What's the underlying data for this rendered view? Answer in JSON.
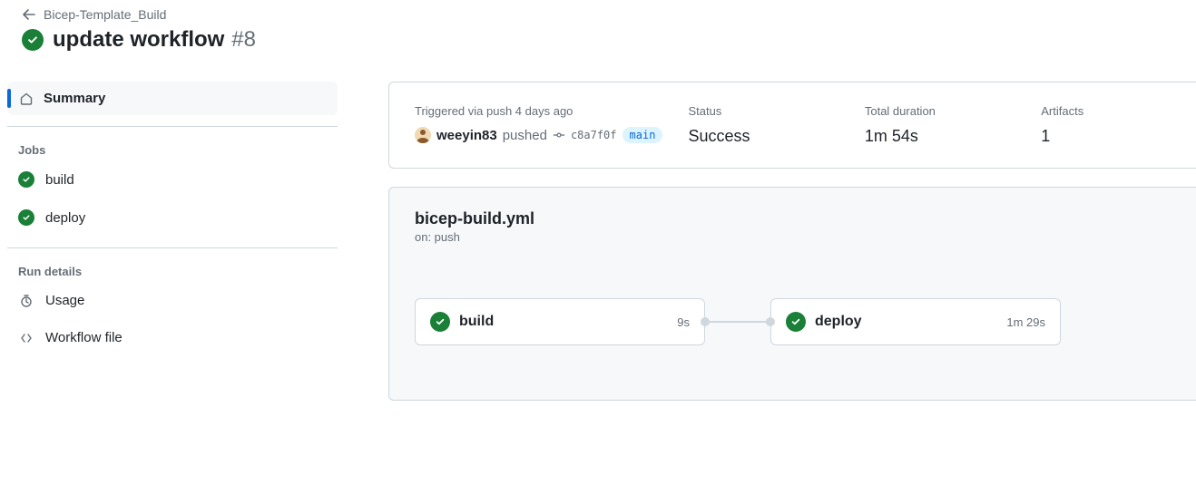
{
  "header": {
    "breadcrumb": "Bicep-Template_Build",
    "title": "update workflow",
    "run_number": "#8"
  },
  "sidebar": {
    "summary_label": "Summary",
    "jobs_heading": "Jobs",
    "jobs": [
      {
        "name": "build"
      },
      {
        "name": "deploy"
      }
    ],
    "run_details_heading": "Run details",
    "usage_label": "Usage",
    "workflow_file_label": "Workflow file"
  },
  "summary": {
    "trigger_label": "Triggered via push 4 days ago",
    "actor": "weeyin83",
    "action_suffix": "pushed",
    "commit_sha": "c8a7f0f",
    "branch": "main",
    "status_label": "Status",
    "status_value": "Success",
    "duration_label": "Total duration",
    "duration_value": "1m 54s",
    "artifacts_label": "Artifacts",
    "artifacts_value": "1"
  },
  "graph": {
    "workflow_file": "bicep-build.yml",
    "trigger_text": "on: push",
    "nodes": [
      {
        "name": "build",
        "duration": "9s"
      },
      {
        "name": "deploy",
        "duration": "1m 29s"
      }
    ]
  }
}
